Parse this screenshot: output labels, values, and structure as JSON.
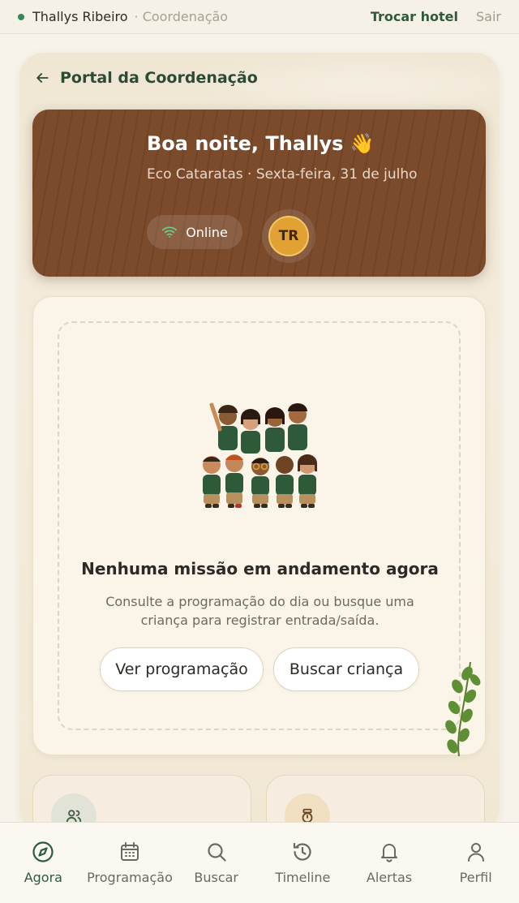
{
  "topbar": {
    "user_name": "Thallys Ribeiro",
    "role": "· Coordenação",
    "switch_hotel": "Trocar hotel",
    "logout": "Sair"
  },
  "header": {
    "back_label": "Portal da Coordenação"
  },
  "greeting": {
    "title": "Boa noite, Thallys 👋",
    "subtitle": "Eco Cataratas · Sexta-feira, 31 de julho",
    "status": "Online",
    "avatar_initials": "TR"
  },
  "empty_state": {
    "title": "Nenhuma missão em andamento agora",
    "description": "Consulte a programação do dia ou busque uma criança para registrar entrada/saída.",
    "primary_button": "Ver programação",
    "secondary_button": "Buscar criança"
  },
  "tiles": [
    {
      "icon": "users-icon"
    },
    {
      "icon": "stopwatch-icon"
    }
  ],
  "nav": {
    "items": [
      {
        "label": "Agora",
        "icon": "compass-icon",
        "active": true
      },
      {
        "label": "Programação",
        "icon": "calendar-icon",
        "active": false
      },
      {
        "label": "Buscar",
        "icon": "search-icon",
        "active": false
      },
      {
        "label": "Timeline",
        "icon": "history-icon",
        "active": false
      },
      {
        "label": "Alertas",
        "icon": "bell-icon",
        "active": false
      },
      {
        "label": "Perfil",
        "icon": "user-icon",
        "active": false
      }
    ]
  },
  "colors": {
    "accent": "#2d5a3c",
    "greeting_card": "#7c4b2c",
    "online_dot": "#2e8b57",
    "avatar": "#e1a233"
  }
}
